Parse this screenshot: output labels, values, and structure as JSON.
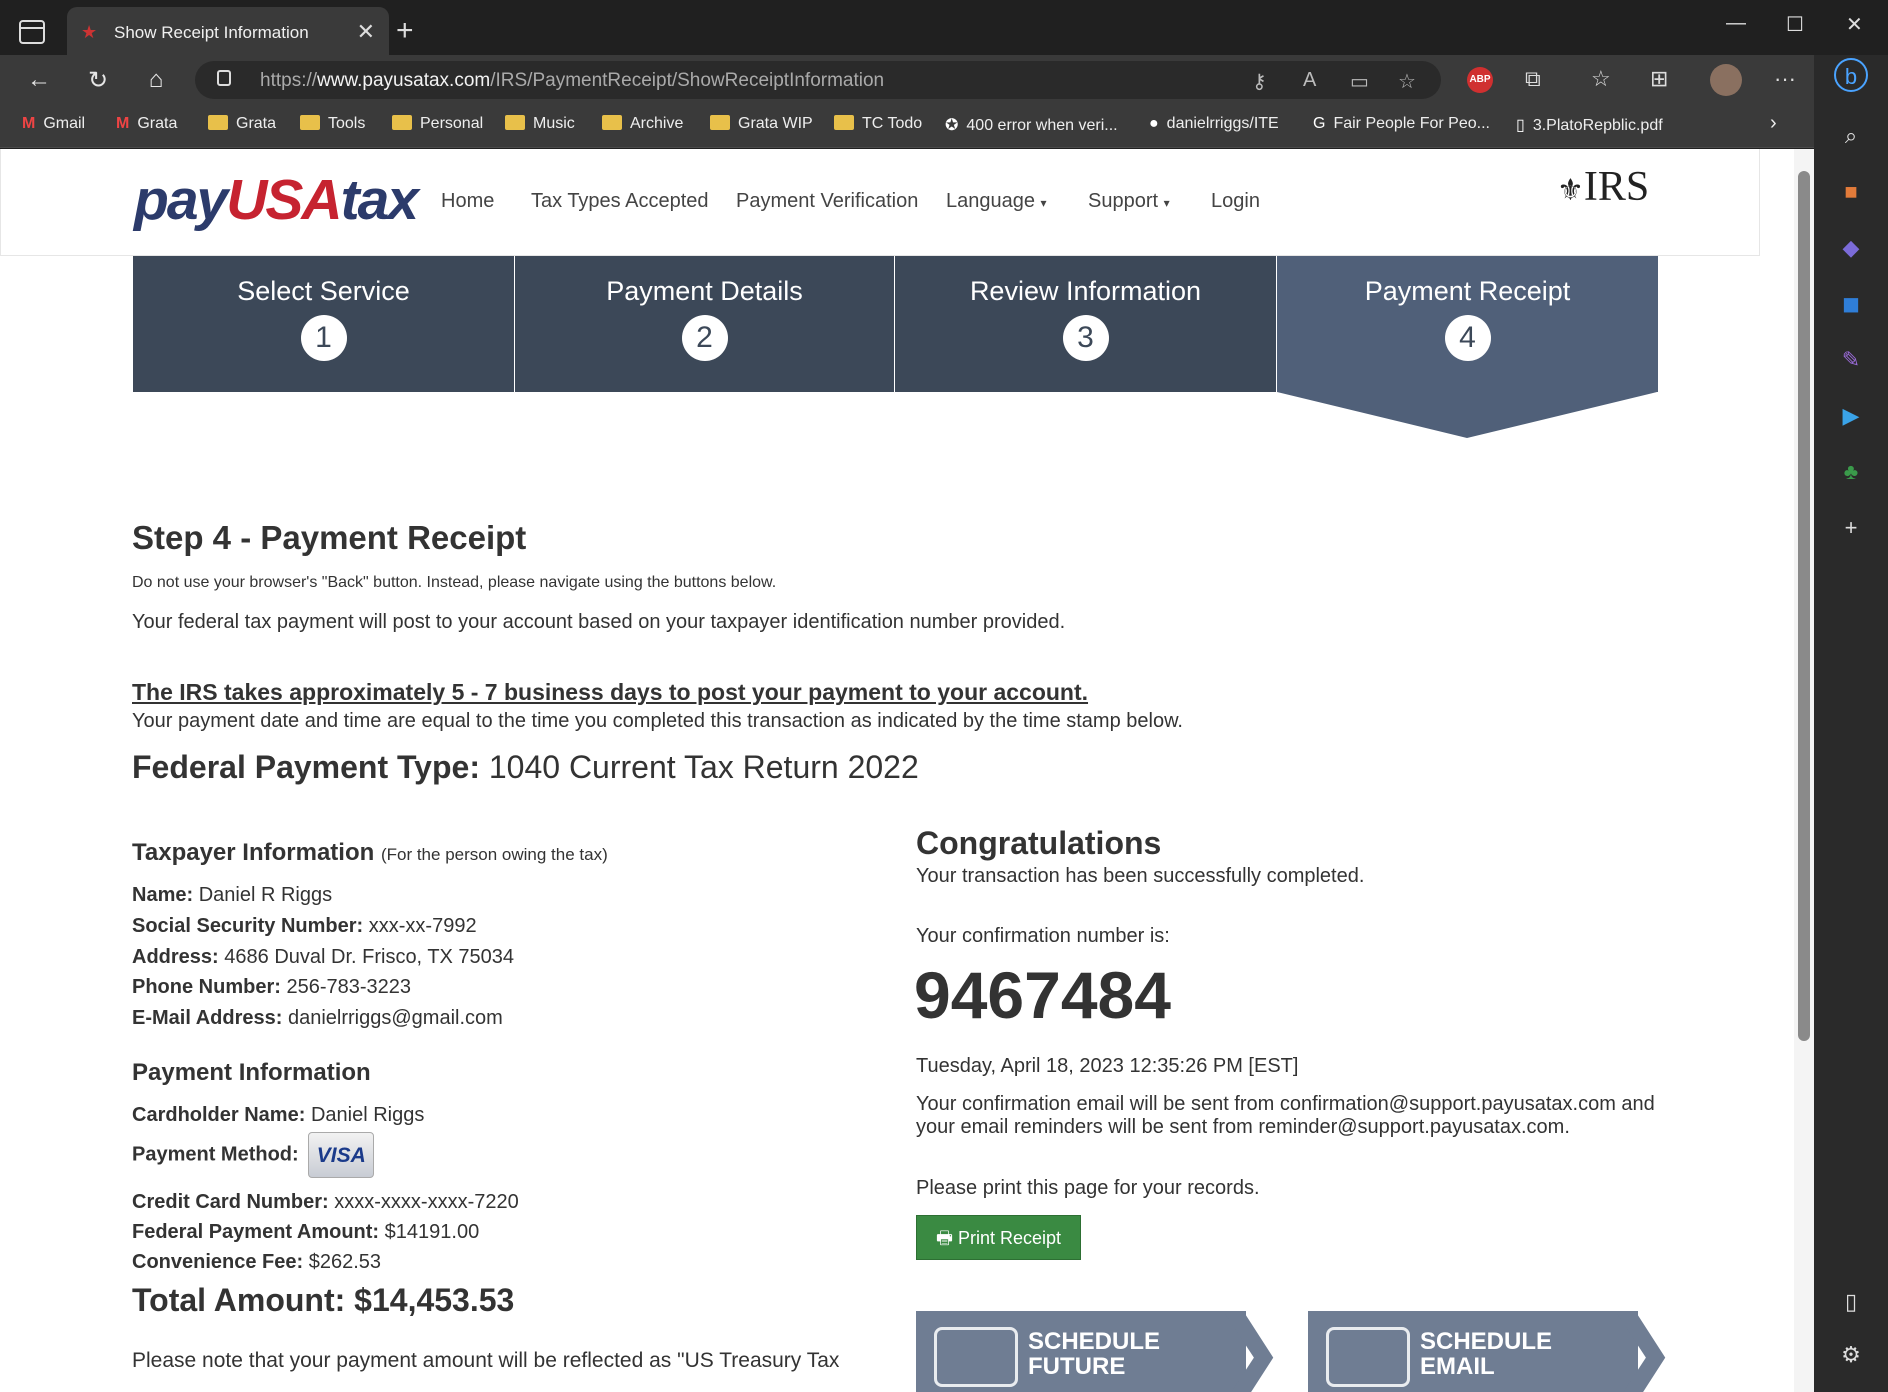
{
  "browser": {
    "tab_title": "Show Receipt Information",
    "url_prefix": "https://",
    "url_domain": "www.payusatax.com",
    "url_path": "/IRS/PaymentReceipt/ShowReceiptInformation",
    "bookmarks": [
      {
        "label": "Gmail",
        "icon": "gmail-icon"
      },
      {
        "label": "Grata",
        "icon": "gmail-icon"
      },
      {
        "label": "Grata",
        "icon": "folder-icon"
      },
      {
        "label": "Tools",
        "icon": "folder-icon"
      },
      {
        "label": "Personal",
        "icon": "folder-icon"
      },
      {
        "label": "Music",
        "icon": "folder-icon"
      },
      {
        "label": "Archive",
        "icon": "folder-icon"
      },
      {
        "label": "Grata WIP",
        "icon": "folder-icon"
      },
      {
        "label": "TC Todo",
        "icon": "folder-icon"
      },
      {
        "label": "400 error when veri...",
        "icon": "star-badge-icon"
      },
      {
        "label": "danielrriggs/ITE",
        "icon": "github-icon"
      },
      {
        "label": "Fair People For Peo...",
        "icon": "google-icon"
      },
      {
        "label": "3.PlatoRepblic.pdf",
        "icon": "file-icon"
      }
    ],
    "abp_label": "ABP"
  },
  "site": {
    "logo_pre": "pay",
    "logo_usa": "USA",
    "logo_post": "tax",
    "nav": [
      "Home",
      "Tax Types Accepted",
      "Payment Verification",
      "Language",
      "Support",
      "Login"
    ],
    "irs_logo": "IRS"
  },
  "steps": [
    {
      "title": "Select Service",
      "num": "1"
    },
    {
      "title": "Payment Details",
      "num": "2"
    },
    {
      "title": "Review Information",
      "num": "3"
    },
    {
      "title": "Payment Receipt",
      "num": "4"
    }
  ],
  "content": {
    "heading": "Step 4 - Payment Receipt",
    "back_note": "Do not use your browser's \"Back\" button. Instead, please navigate using the buttons below.",
    "post_note": "Your federal tax payment will post to your account based on your taxpayer identification number provided.",
    "irs_warning": "The IRS takes approximately 5 - 7 business days to post your payment to your account.",
    "time_note": "Your payment date and time are equal to the time you completed this transaction as indicated by the time stamp below.",
    "payment_type_label": "Federal Payment Type:",
    "payment_type_value": "1040 Current Tax Return 2022"
  },
  "taxpayer": {
    "title": "Taxpayer Information",
    "subtitle": "(For the person owing the tax)",
    "name_label": "Name:",
    "name": "Daniel R Riggs",
    "ssn_label": "Social Security Number:",
    "ssn": "xxx-xx-7992",
    "address_label": "Address:",
    "address": "4686 Duval Dr. Frisco, TX 75034",
    "phone_label": "Phone Number:",
    "phone": "256-783-3223",
    "email_label": "E-Mail Address:",
    "email": "danielrriggs@gmail.com"
  },
  "payment": {
    "title": "Payment Information",
    "cardholder_label": "Cardholder Name:",
    "cardholder": "Daniel Riggs",
    "method_label": "Payment Method:",
    "method_badge": "VISA",
    "card_label": "Credit Card Number:",
    "card": "xxxx-xxxx-xxxx-7220",
    "amount_label": "Federal Payment Amount:",
    "amount": "$14191.00",
    "fee_label": "Convenience Fee:",
    "fee": "$262.53",
    "total": "Total Amount: $14,453.53",
    "reflect_note": "Please note that your payment amount will be reflected as \"US Treasury Tax"
  },
  "confirmation": {
    "title": "Congratulations",
    "success": "Your transaction has been successfully completed.",
    "number_label": "Your confirmation number is:",
    "number": "9467484",
    "timestamp": "Tuesday, April 18, 2023 12:35:26 PM [EST]",
    "email_note": "Your confirmation email will be sent from confirmation@support.payusatax.com and your email reminders will be sent from reminder@support.payusatax.com.",
    "print_note": "Please print this page for your records.",
    "print_button": "Print Receipt"
  },
  "banners": [
    {
      "line1": "SCHEDULE",
      "line2": "FUTURE"
    },
    {
      "line1": "SCHEDULE",
      "line2": "EMAIL"
    }
  ]
}
